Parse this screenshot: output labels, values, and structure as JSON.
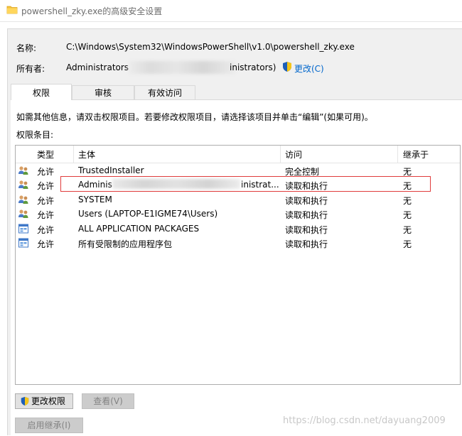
{
  "window": {
    "title": "powershell_zky.exe的高级安全设置"
  },
  "fields": {
    "name_label": "名称:",
    "name_value": "C:\\Windows\\System32\\WindowsPowerShell\\v1.0\\powershell_zky.exe",
    "owner_label": "所有者:",
    "owner_value_start": "Administrators",
    "owner_value_end": "inistrators)",
    "change_owner_link": "更改(C)"
  },
  "tabs": [
    {
      "label": "权限",
      "active": true
    },
    {
      "label": "审核",
      "active": false
    },
    {
      "label": "有效访问",
      "active": false
    }
  ],
  "info_text": "如需其他信息，请双击权限项目。若要修改权限项目，请选择该项目并单击“编辑”(如果可用)。",
  "entries_label": "权限条目:",
  "table": {
    "columns": [
      "类型",
      "主体",
      "访问",
      "继承于"
    ],
    "rows": [
      {
        "icon": "users-icon",
        "type": "允许",
        "principal": "TrustedInstaller",
        "access": "完全控制",
        "inherited": "无"
      },
      {
        "icon": "users-icon",
        "type": "允许",
        "principal": "Adminis",
        "principal_tail": "inistrat...",
        "access": "读取和执行",
        "inherited": "无"
      },
      {
        "icon": "users-icon",
        "type": "允许",
        "principal": "SYSTEM",
        "access": "读取和执行",
        "inherited": "无"
      },
      {
        "icon": "users-icon",
        "type": "允许",
        "principal": "Users (LAPTOP-E1IGME74\\Users)",
        "access": "读取和执行",
        "inherited": "无"
      },
      {
        "icon": "package-icon",
        "type": "允许",
        "principal": "ALL APPLICATION PACKAGES",
        "access": "读取和执行",
        "inherited": "无"
      },
      {
        "icon": "package-icon",
        "type": "允许",
        "principal": "所有受限制的应用程序包",
        "access": "读取和执行",
        "inherited": "无"
      }
    ]
  },
  "buttons": {
    "change_permissions": "更改权限",
    "view": "查看(V)",
    "enable_inheritance": "启用继承(I)"
  },
  "watermark": "https://blog.csdn.net/dayuang2009",
  "colors": {
    "accent_link": "#0066cc",
    "highlight": "#e03c3c"
  }
}
